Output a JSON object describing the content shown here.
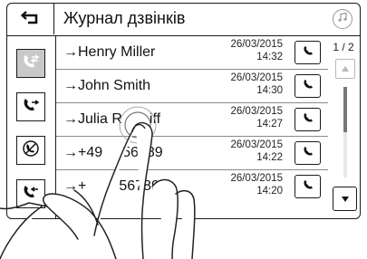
{
  "header": {
    "title": "Журнал дзвінків",
    "back_icon": "back-arrow-icon",
    "music_icon": "music-note-icon"
  },
  "sidebar": {
    "filters": [
      {
        "icon": "all-calls-icon",
        "active": true
      },
      {
        "icon": "outgoing-call-icon",
        "active": false
      },
      {
        "icon": "missed-call-icon",
        "active": false
      },
      {
        "icon": "incoming-call-icon",
        "active": false
      }
    ]
  },
  "calls": [
    {
      "name": "→Henry Miller",
      "date": "26/03/2015",
      "time": "14:32"
    },
    {
      "name": "→John Smith",
      "date": "26/03/2015",
      "time": "14:30"
    },
    {
      "name": "→Julia R",
      "name_tail": "iff",
      "date": "26/03/2015",
      "time": "14:27"
    },
    {
      "name": "→+49",
      "name_tail": "56789",
      "date": "26/03/2015",
      "time": "14:22"
    },
    {
      "name": "→+",
      "name_tail": "567891",
      "date": "26/03/2015",
      "time": "14:20"
    }
  ],
  "scroll": {
    "page_indicator": "1 / 2",
    "position_fraction": 0.0,
    "visible_fraction": 0.5
  },
  "colors": {
    "frame": "#1a1a1a",
    "active_filter_bg": "#c9c9c9"
  }
}
